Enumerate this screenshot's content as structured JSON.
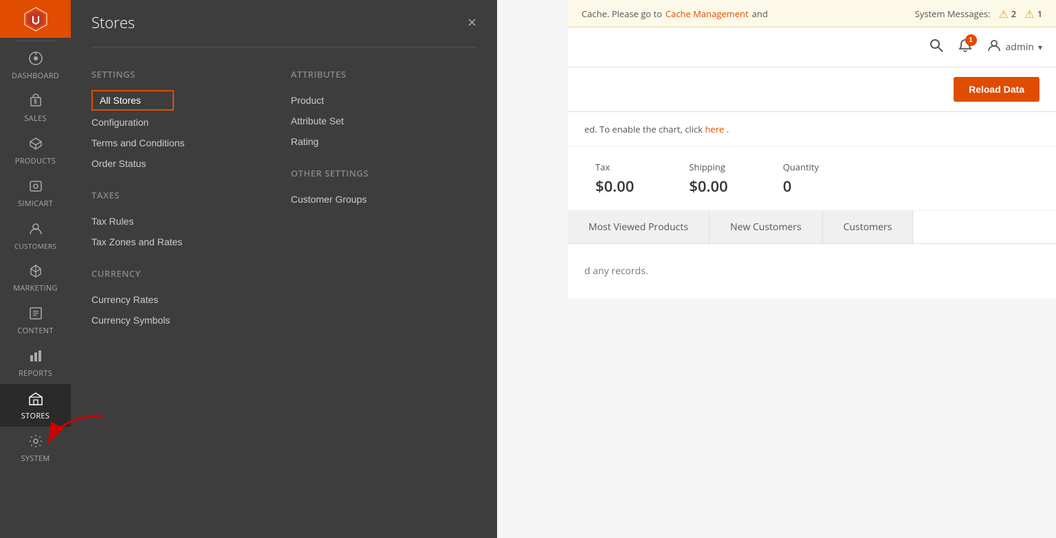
{
  "sidebar": {
    "logo_alt": "Magento Logo",
    "items": [
      {
        "id": "dashboard",
        "label": "Dashboard",
        "icon": "⊙"
      },
      {
        "id": "sales",
        "label": "Sales",
        "icon": "$"
      },
      {
        "id": "products",
        "label": "Products",
        "icon": "⬡"
      },
      {
        "id": "simicart",
        "label": "Simicart",
        "icon": "⬡"
      },
      {
        "id": "customers",
        "label": "Customers",
        "icon": "👤"
      },
      {
        "id": "marketing",
        "label": "Marketing",
        "icon": "📣"
      },
      {
        "id": "content",
        "label": "Content",
        "icon": "▦"
      },
      {
        "id": "reports",
        "label": "Reports",
        "icon": "▦"
      },
      {
        "id": "stores",
        "label": "Stores",
        "icon": "🏪",
        "active": true
      },
      {
        "id": "system",
        "label": "System",
        "icon": "⚙"
      }
    ]
  },
  "stores_menu": {
    "title": "Stores",
    "close_label": "×",
    "settings": {
      "label": "Settings",
      "items": [
        {
          "id": "all-stores",
          "label": "All Stores",
          "active": true
        },
        {
          "id": "configuration",
          "label": "Configuration"
        },
        {
          "id": "terms-conditions",
          "label": "Terms and Conditions"
        },
        {
          "id": "order-status",
          "label": "Order Status"
        }
      ]
    },
    "taxes": {
      "label": "Taxes",
      "items": [
        {
          "id": "tax-rules",
          "label": "Tax Rules"
        },
        {
          "id": "tax-zones-rates",
          "label": "Tax Zones and Rates"
        }
      ]
    },
    "currency": {
      "label": "Currency",
      "items": [
        {
          "id": "currency-rates",
          "label": "Currency Rates"
        },
        {
          "id": "currency-symbols",
          "label": "Currency Symbols"
        }
      ]
    },
    "attributes": {
      "label": "Attributes",
      "items": [
        {
          "id": "product",
          "label": "Product"
        },
        {
          "id": "attribute-set",
          "label": "Attribute Set"
        },
        {
          "id": "rating",
          "label": "Rating"
        }
      ]
    },
    "other_settings": {
      "label": "Other Settings",
      "items": [
        {
          "id": "customer-groups",
          "label": "Customer Groups"
        }
      ]
    }
  },
  "notification_bar": {
    "cache_message_prefix": "Cache. Please go to",
    "cache_link_text": "Cache Management",
    "cache_message_suffix": "and",
    "system_messages_label": "System Messages:",
    "warnings": [
      {
        "count": "2"
      },
      {
        "count": "1"
      }
    ]
  },
  "header": {
    "user_name": "admin",
    "notification_count": "1"
  },
  "dashboard": {
    "reload_button_label": "Reload Data",
    "chart_notice_prefix": "ed. To enable the chart, click",
    "chart_notice_link": "here",
    "chart_notice_suffix": ".",
    "stats": [
      {
        "label": "Tax",
        "value": "$0.00"
      },
      {
        "label": "Shipping",
        "value": "$0.00"
      },
      {
        "label": "Quantity",
        "value": "0"
      }
    ],
    "tabs": [
      {
        "id": "most-viewed",
        "label": "Most Viewed Products"
      },
      {
        "id": "new-customers",
        "label": "New Customers"
      },
      {
        "id": "customers",
        "label": "Customers"
      }
    ],
    "no_records_message": "d any records."
  }
}
